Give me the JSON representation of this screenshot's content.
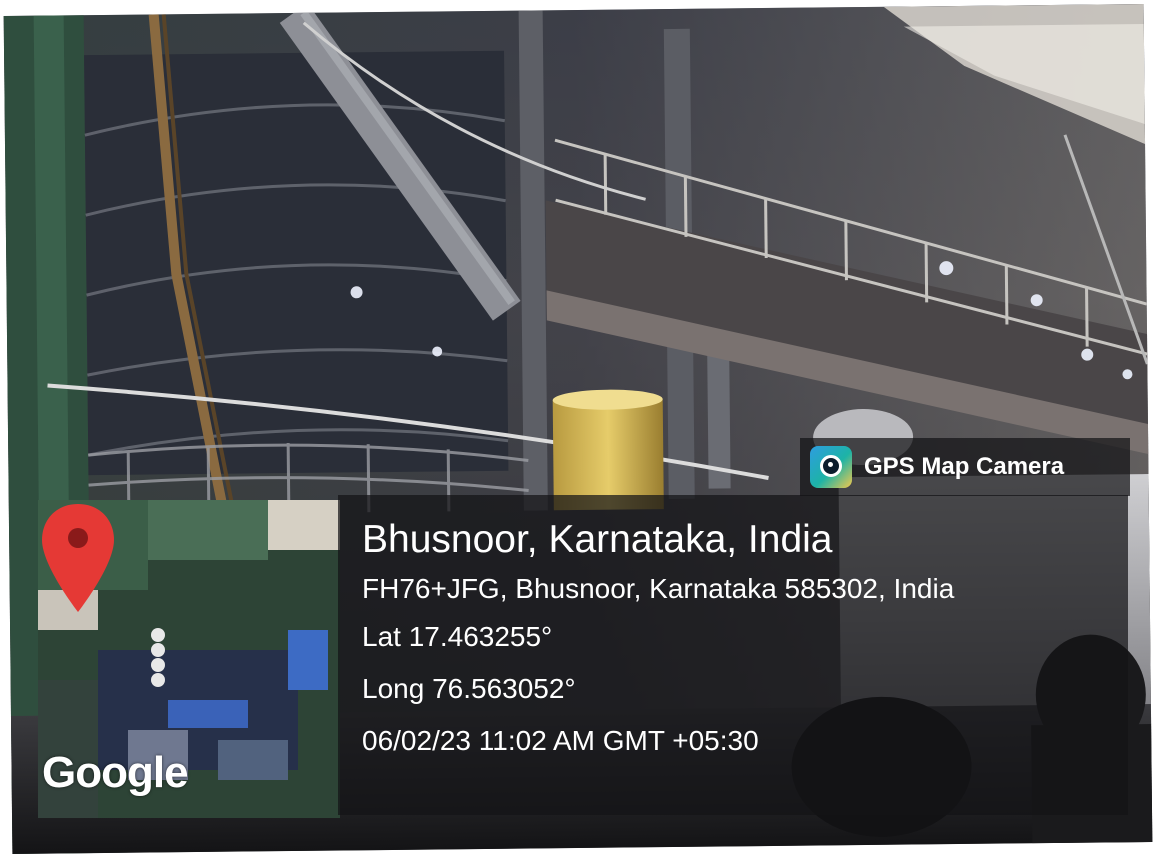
{
  "overlay": {
    "app_name": "GPS Map Camera",
    "brand_color": "#1db3a6",
    "map_logo": "Google",
    "location_title": "Bhusnoor, Karnataka, India",
    "address": "FH76+JFG, Bhusnoor, Karnataka 585302, India",
    "latitude": "Lat 17.463255°",
    "longitude": "Long 76.563052°",
    "datetime": "06/02/23 11:02 AM GMT +05:30"
  },
  "icons": {
    "app": "camera-lens-icon",
    "map_pin": "map-pin-icon"
  },
  "colors": {
    "pin_red": "#e53935",
    "panel_bg": "rgba(20,20,22,0.72)",
    "text": "#ffffff"
  }
}
